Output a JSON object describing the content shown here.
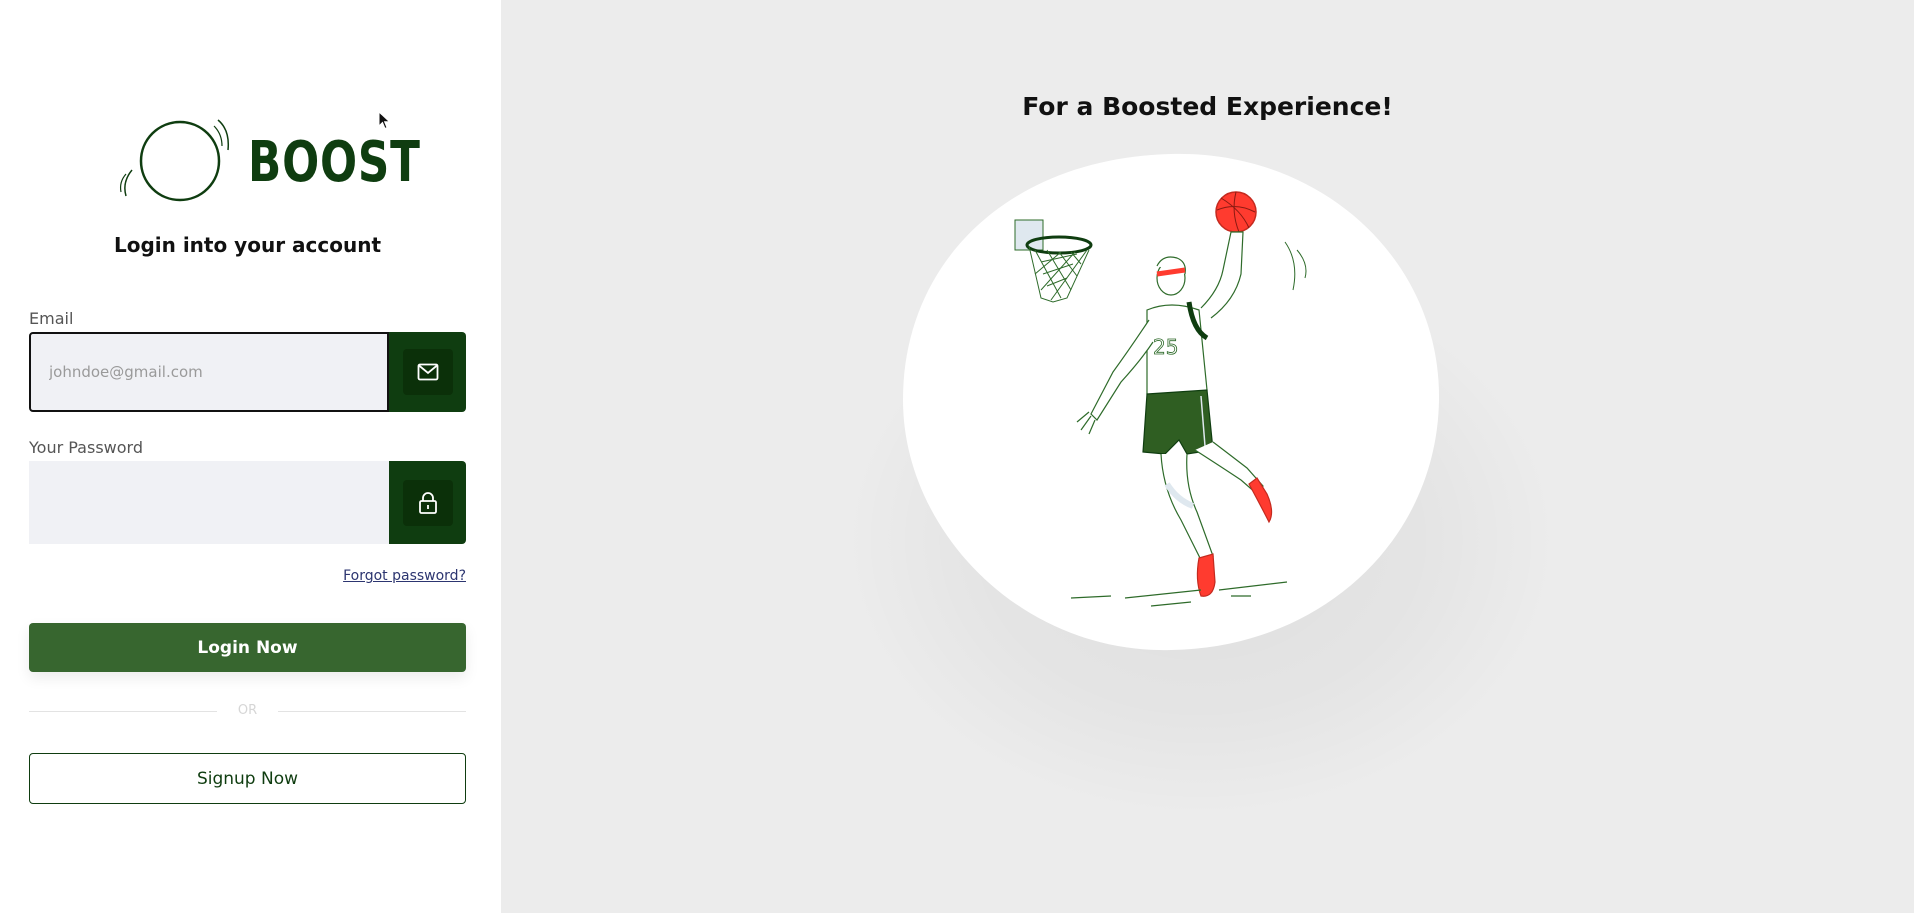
{
  "brand": {
    "name": "BOOST"
  },
  "login": {
    "heading": "Login into your account",
    "email_label": "Email",
    "email_placeholder": "johndoe@gmail.com",
    "password_label": "Your Password",
    "password_placeholder": "",
    "forgot_label": "Forgot password?",
    "login_button": "Login Now",
    "or_text": "OR",
    "signup_button": "Signup Now"
  },
  "hero": {
    "tagline": "For a Boosted Experience!",
    "jersey_number": "25"
  },
  "icons": {
    "email": "mail-icon",
    "password": "lock-icon"
  },
  "colors": {
    "brand_dark_green": "#0f3d10",
    "button_green": "#37662f",
    "accent_red": "#ff3b2f",
    "link_blue": "#2c3570"
  }
}
